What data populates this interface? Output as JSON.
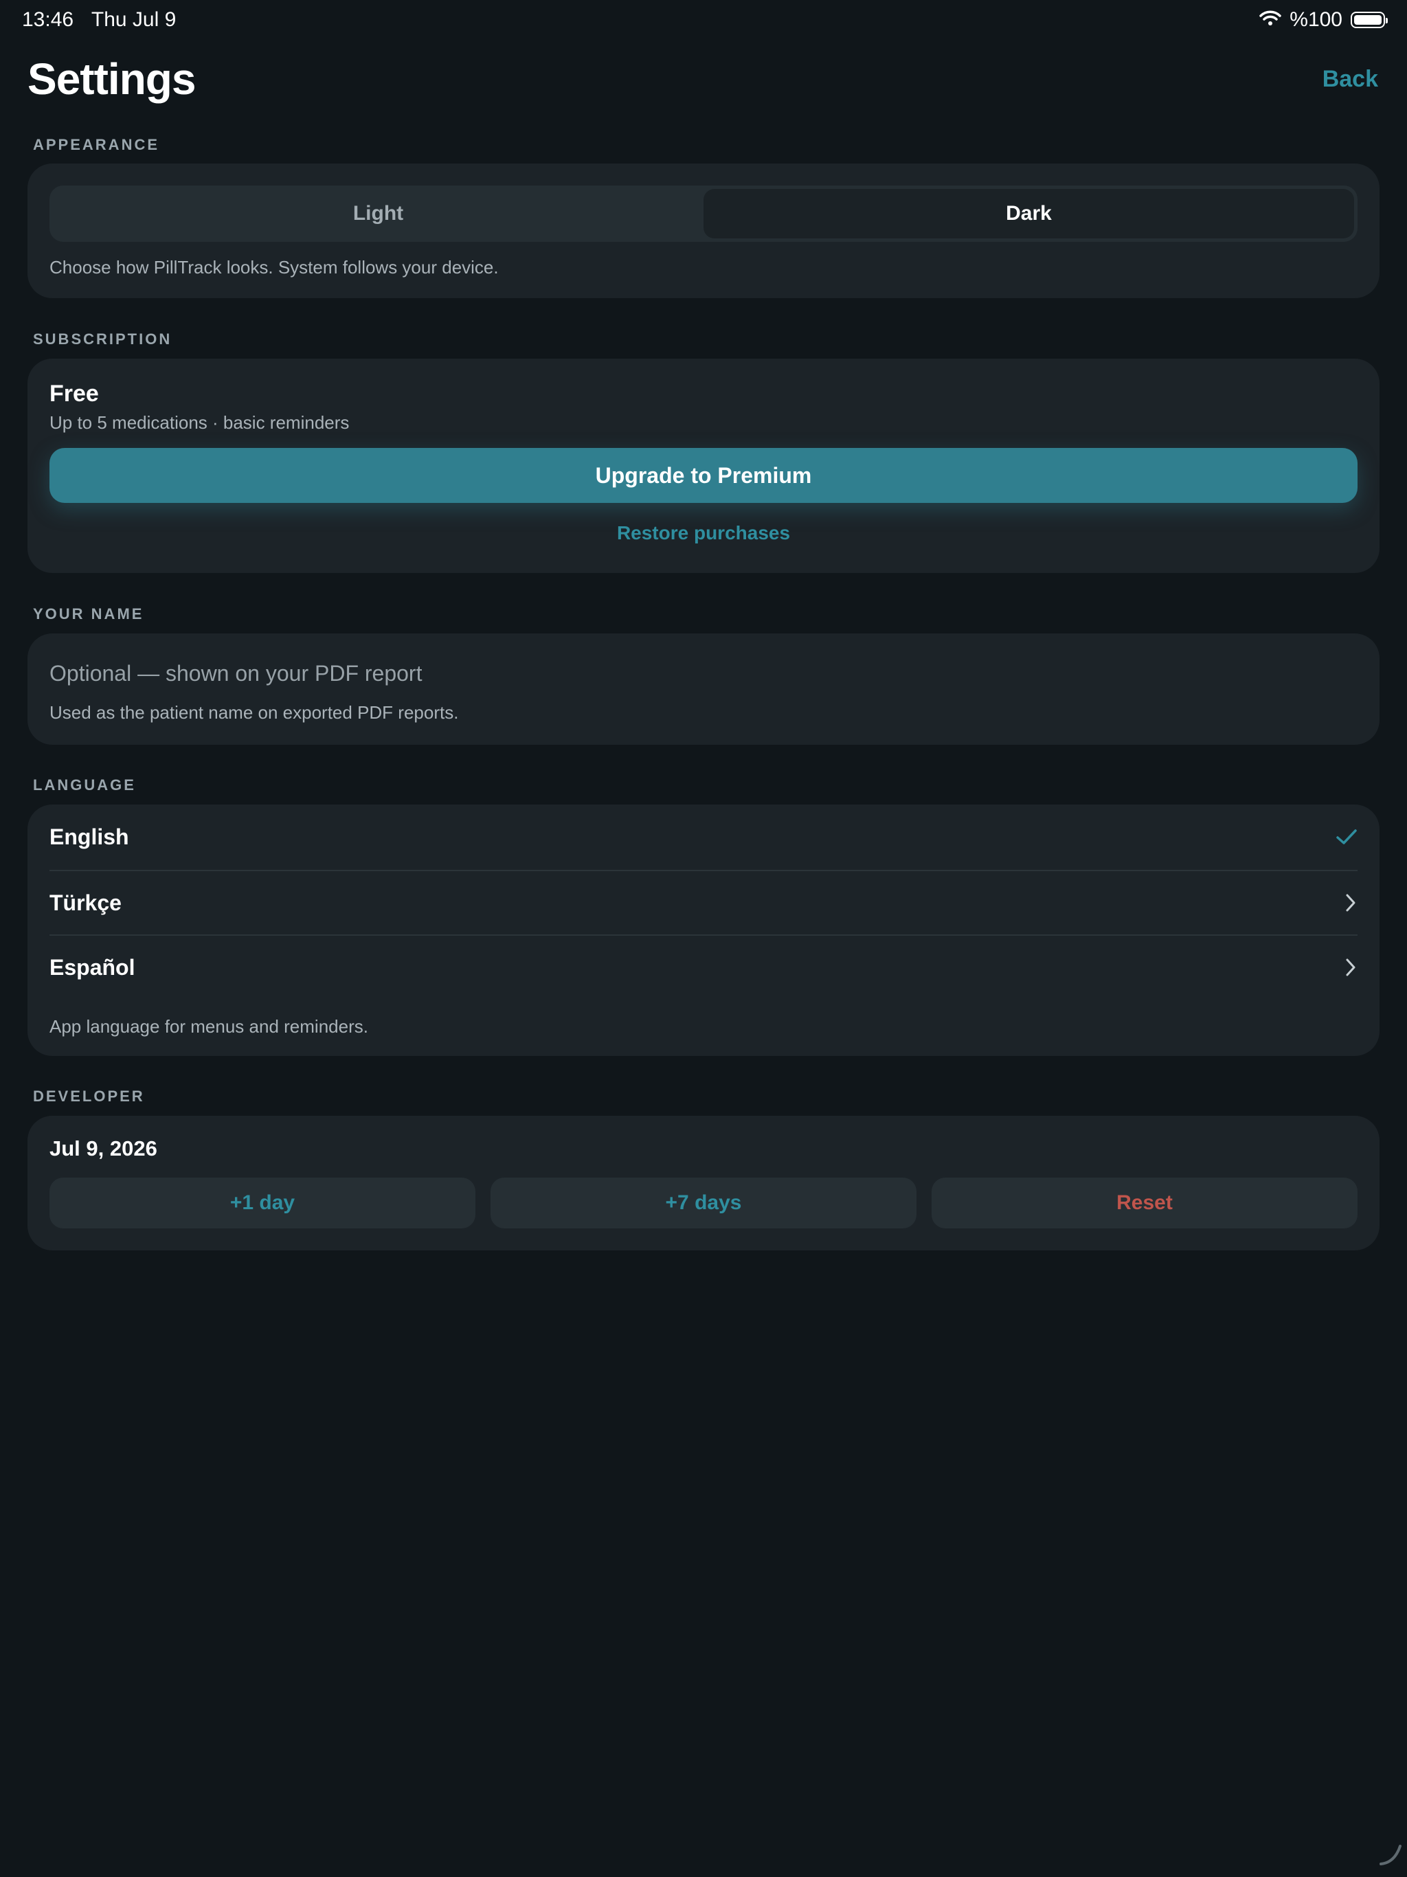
{
  "status_bar": {
    "time": "13:46",
    "date": "Thu Jul 9",
    "battery": "%100",
    "wifi_icon": "wifi-icon",
    "battery_icon": "battery-icon"
  },
  "header": {
    "title": "Settings",
    "back_label": "Back"
  },
  "appearance": {
    "section_label": "APPEARANCE",
    "options": [
      "Light",
      "Dark"
    ],
    "selected": "Dark",
    "help": "Choose how PillTrack looks. System follows your device."
  },
  "subscription": {
    "section_label": "SUBSCRIPTION",
    "plan": "Free",
    "plan_desc": "Up to 5 medications · basic reminders",
    "upgrade_label": "Upgrade to Premium",
    "restore_label": "Restore purchases"
  },
  "your_name": {
    "section_label": "YOUR NAME",
    "value": "",
    "placeholder": "Optional — shown on your PDF report",
    "help": "Used as the patient name on exported PDF reports."
  },
  "language": {
    "section_label": "LANGUAGE",
    "items": [
      {
        "label": "English",
        "icon": "checkmark-icon"
      },
      {
        "label": "Türkçe",
        "icon": "chevron-right-icon"
      },
      {
        "label": "Español",
        "icon": "chevron-right-icon"
      }
    ],
    "selected": "English",
    "help": "App language for menus and reminders."
  },
  "developer": {
    "section_label": "DEVELOPER",
    "date": "Jul 9, 2026",
    "buttons": [
      "+1 day",
      "+7 days",
      "Reset"
    ]
  },
  "colors": {
    "background": "#10161a",
    "card": "#1c2328",
    "accent": "#307f8f",
    "link": "#2f8fa0",
    "danger": "#c0554c"
  }
}
